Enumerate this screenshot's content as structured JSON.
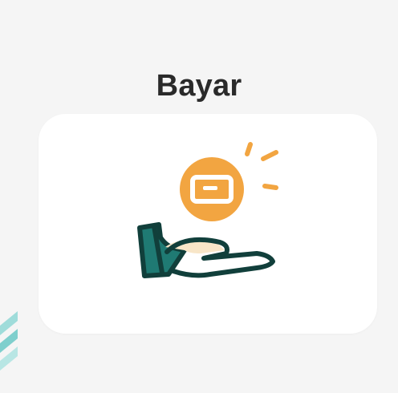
{
  "page": {
    "title": "Bayar"
  },
  "icons": {
    "main": "pay-hand-coin-icon",
    "edge": "decorative-stripes-icon"
  },
  "colors": {
    "background": "#f5f5f5",
    "card": "#ffffff",
    "title_text": "#2a2a2a",
    "coin": "#f2a541",
    "coin_card": "#ffffff",
    "hand_fill": "#1f7a73",
    "hand_outline": "#113f3b",
    "palm": "#f8e6c8",
    "accent_teal": "#7fcfcd"
  }
}
